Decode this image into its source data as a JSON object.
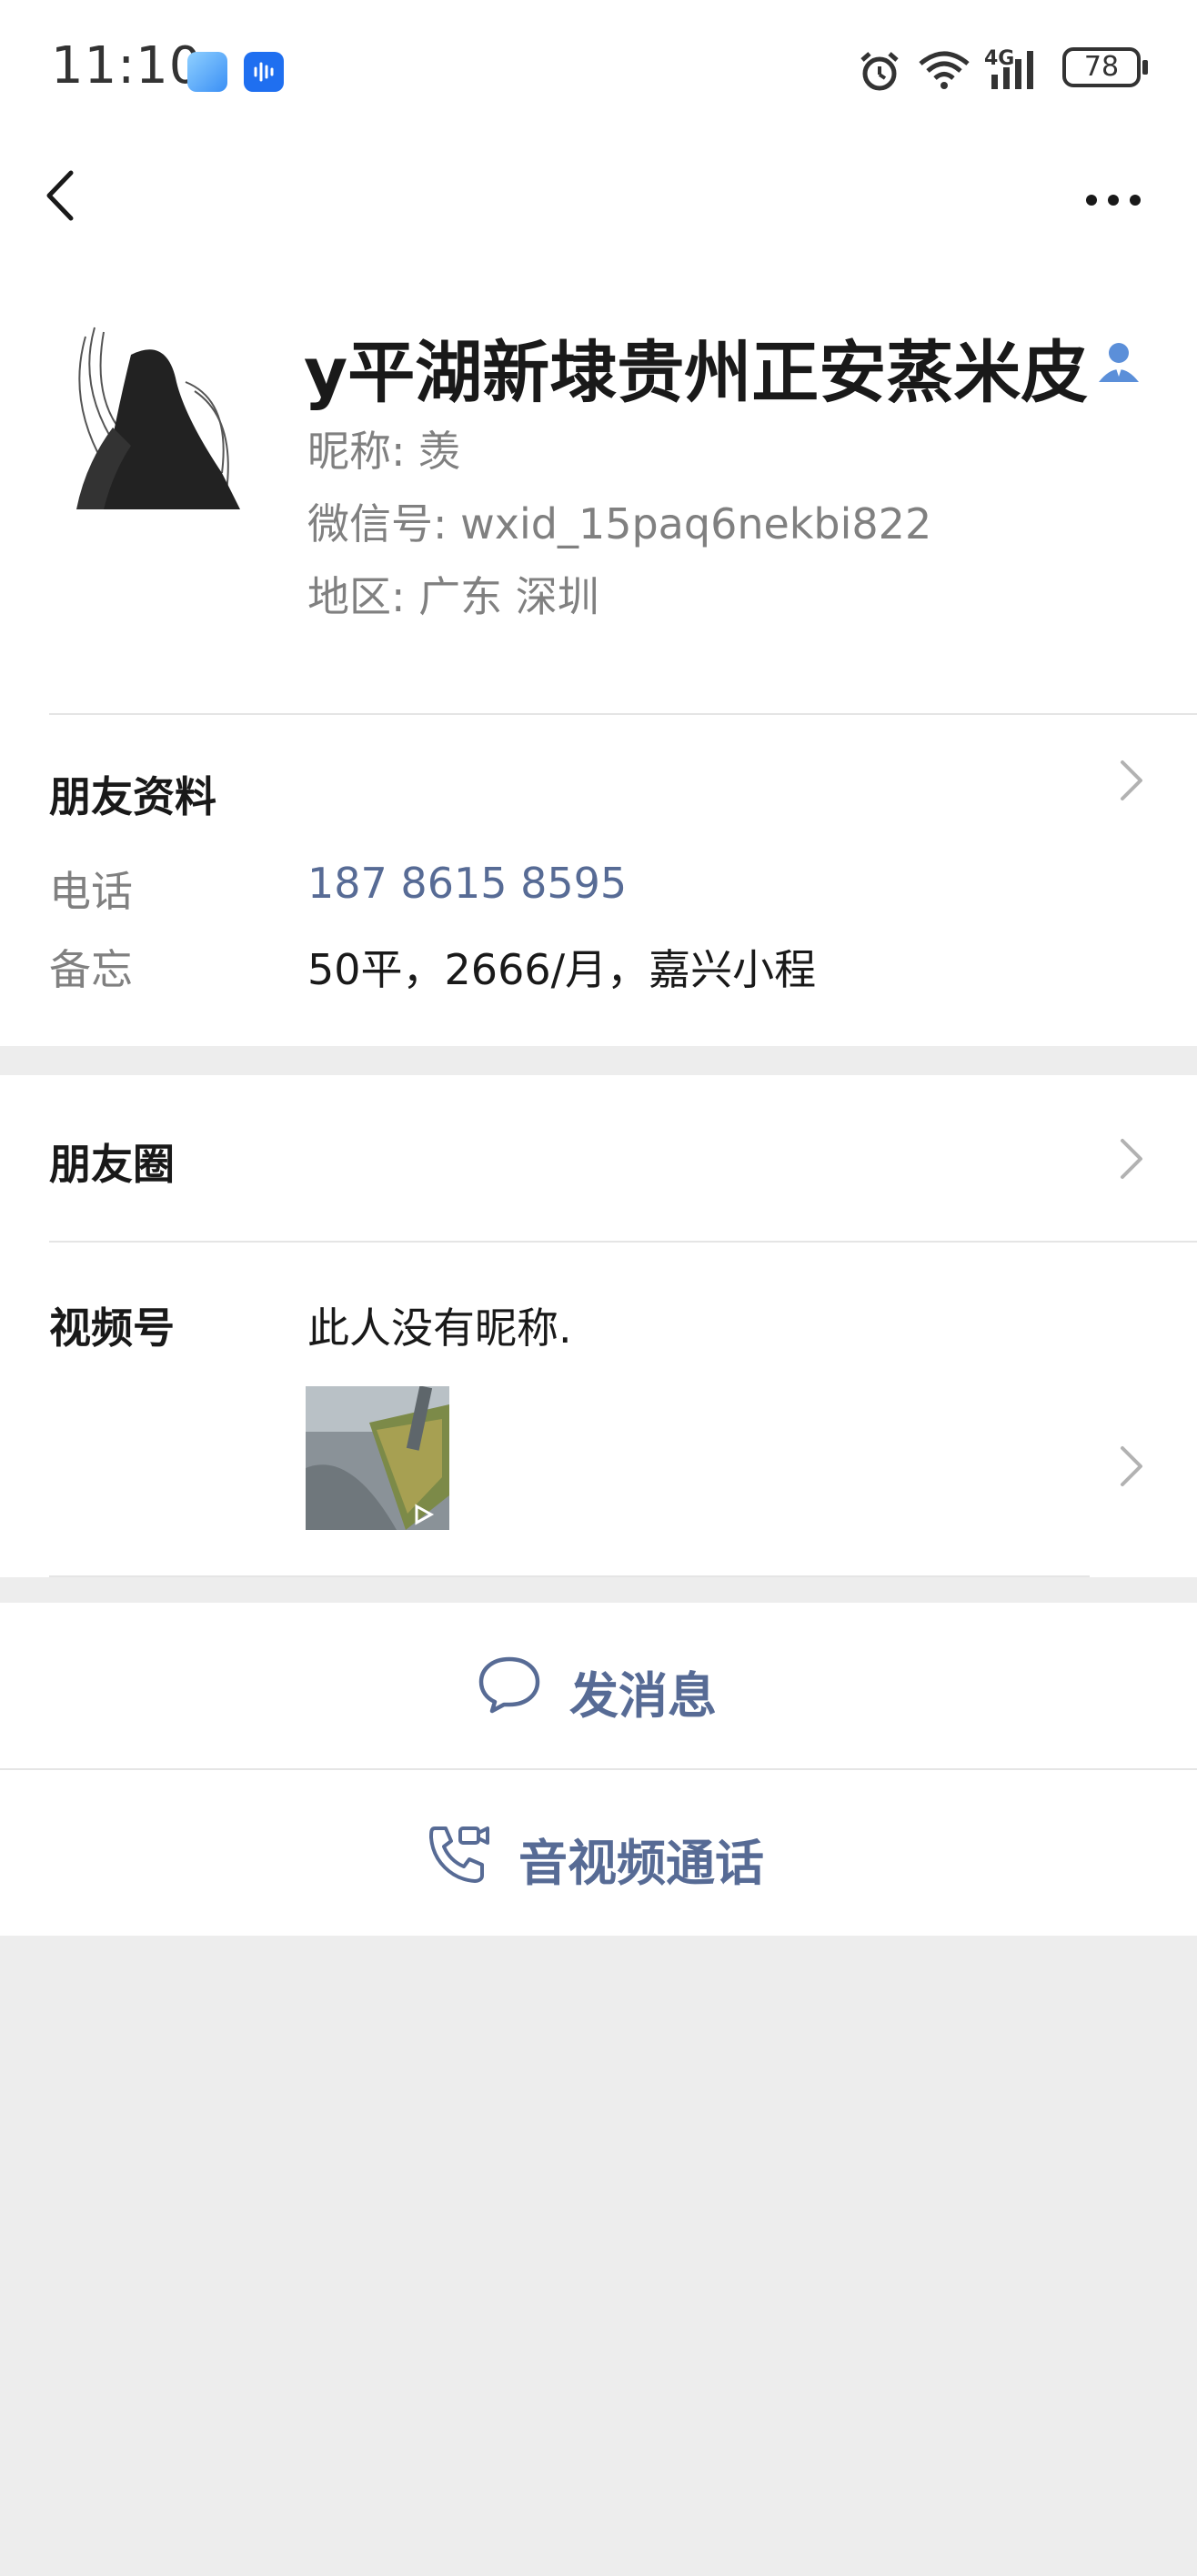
{
  "status_bar": {
    "time": "11:10",
    "battery": "78",
    "network": "4G",
    "icons": [
      "alarm-icon",
      "wifi-icon",
      "signal-icon"
    ]
  },
  "header": {
    "back_icon": "chevron-left-icon",
    "more_icon": "more-dots-icon"
  },
  "profile": {
    "name": "y平湖新埭贵州正安蒸米皮",
    "nickname": "昵称:  羡",
    "wechat_id": "微信号:  wxid_15paq6nekbi822",
    "region": "地区:  广东  深圳"
  },
  "friend_info": {
    "title": "朋友资料",
    "phone_label": "电话",
    "phone_value": "187 8615 8595",
    "note_label": "备忘",
    "note_value": "50平，2666/月，嘉兴小程"
  },
  "moments": {
    "title": "朋友圈"
  },
  "channels": {
    "title": "视频号",
    "value": "此人没有昵称."
  },
  "actions": {
    "message": "发消息",
    "call": "音视频通话"
  },
  "colors": {
    "link": "#576b95",
    "background": "#ededed",
    "contact_badge": "#5b8fd9"
  }
}
